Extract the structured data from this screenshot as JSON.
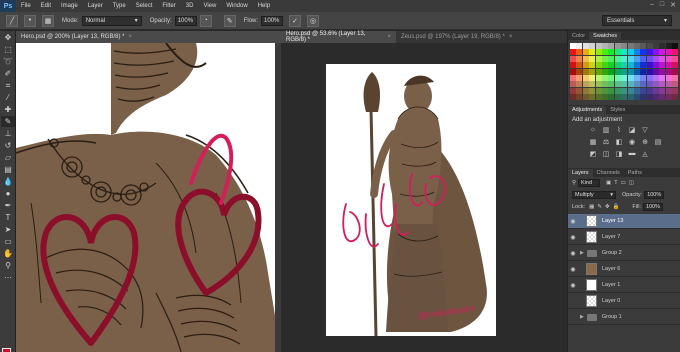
{
  "app": {
    "logo": "Ps",
    "menu": [
      "File",
      "Edit",
      "Image",
      "Layer",
      "Type",
      "Select",
      "Filter",
      "3D",
      "View",
      "Window",
      "Help"
    ],
    "window_controls": [
      "–",
      "□",
      "✕"
    ]
  },
  "options_bar": {
    "mode_label": "Mode:",
    "mode_value": "Normal",
    "opacity_label": "Opacity:",
    "opacity_value": "100%",
    "flow_label": "Flow:",
    "flow_value": "100%",
    "workspace": "Essentials"
  },
  "tabs": [
    {
      "label": "Hero.psd @ 200% (Layer 13, RGB/8) *",
      "close": "×"
    },
    {
      "label": "Hero.psd @ 53.6% (Layer 13, RGB/8) *",
      "close": "×"
    },
    {
      "label": "Zeus.psd @ 197% (Layer 19, RGB/8) *",
      "close": "×"
    }
  ],
  "watermark": "@imilyartwork",
  "panels": {
    "swatch_tabs": [
      "Color",
      "Swatches"
    ],
    "adjust_tabs": [
      "Adjustments",
      "Styles"
    ],
    "add_adjustment": "Add an adjustment",
    "layer_tabs": [
      "Layers",
      "Channels",
      "Paths"
    ],
    "kind_label": "Kind",
    "blend_mode": "Multiply",
    "opacity_label": "Opacity:",
    "opacity_value": "100%",
    "lock_label": "Lock:",
    "fill_label": "Fill:",
    "fill_value": "100%"
  },
  "layers": [
    {
      "name": "Layer 13",
      "type": "layer",
      "thumb": "checker",
      "visible": true,
      "selected": true
    },
    {
      "name": "Layer 7",
      "type": "layer",
      "thumb": "checker",
      "visible": true,
      "selected": false
    },
    {
      "name": "Group 2",
      "type": "group",
      "visible": true,
      "selected": false
    },
    {
      "name": "Layer 6",
      "type": "layer",
      "thumb": "fig",
      "visible": true,
      "selected": false
    },
    {
      "name": "Layer 1",
      "type": "layer",
      "thumb": "white",
      "visible": true,
      "selected": false
    },
    {
      "name": "Layer 0",
      "type": "layer",
      "thumb": "checker",
      "visible": false,
      "selected": false
    },
    {
      "name": "Group 1",
      "type": "group",
      "visible": false,
      "selected": false
    }
  ],
  "colors": {
    "skin": "#7a6048",
    "line": "#2a1e14",
    "heart": "#8b0f2a",
    "pink": "#d41e5a",
    "foreground": "#c8102e",
    "selection": "#5a6d8a"
  }
}
